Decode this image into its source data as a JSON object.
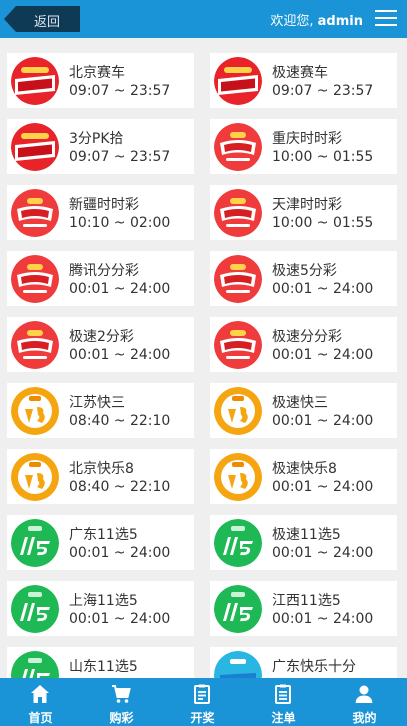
{
  "header": {
    "back_label": "返回",
    "welcome_prefix": "欢迎您, ",
    "username": "admin"
  },
  "lotteries": [
    {
      "name": "北京赛车",
      "time": "09:07 ~ 23:57",
      "icon": "pk10-logo-icon"
    },
    {
      "name": "极速赛车",
      "time": "09:07 ~ 23:57",
      "icon": "pk10-logo-icon"
    },
    {
      "name": "3分PK拾",
      "time": "09:07 ~ 23:57",
      "icon": "pk10-logo-icon"
    },
    {
      "name": "重庆时时彩",
      "time": "10:00 ~ 01:55",
      "icon": "ssc-logo-icon"
    },
    {
      "name": "新疆时时彩",
      "time": "10:10 ~ 02:00",
      "icon": "ssc-logo-icon"
    },
    {
      "name": "天津时时彩",
      "time": "10:00 ~ 01:55",
      "icon": "ssc-logo-icon"
    },
    {
      "name": "腾讯分分彩",
      "time": "00:01 ~ 24:00",
      "icon": "ssc-logo-icon"
    },
    {
      "name": "极速5分彩",
      "time": "00:01 ~ 24:00",
      "icon": "ssc-logo-icon"
    },
    {
      "name": "极速2分彩",
      "time": "00:01 ~ 24:00",
      "icon": "ssc-logo-icon"
    },
    {
      "name": "极速分分彩",
      "time": "00:01 ~ 24:00",
      "icon": "ssc-logo-icon"
    },
    {
      "name": "江苏快三",
      "time": "08:40 ~ 22:10",
      "icon": "k3-logo-icon"
    },
    {
      "name": "极速快三",
      "time": "00:01 ~ 24:00",
      "icon": "k3-logo-icon"
    },
    {
      "name": "北京快乐8",
      "time": "08:40 ~ 22:10",
      "icon": "k3-logo-icon"
    },
    {
      "name": "极速快乐8",
      "time": "00:01 ~ 24:00",
      "icon": "k3-logo-icon"
    },
    {
      "name": "广东11选5",
      "time": "00:01 ~ 24:00",
      "icon": "11x5-logo-icon"
    },
    {
      "name": "极速11选5",
      "time": "00:01 ~ 24:00",
      "icon": "11x5-logo-icon"
    },
    {
      "name": "上海11选5",
      "time": "00:01 ~ 24:00",
      "icon": "11x5-logo-icon"
    },
    {
      "name": "江西11选5",
      "time": "00:01 ~ 24:00",
      "icon": "11x5-logo-icon"
    },
    {
      "name": "山东11选5",
      "time": "",
      "icon": "11x5-logo-icon"
    },
    {
      "name": "广东快乐十分",
      "time": "",
      "icon": "klsf-logo-icon"
    }
  ],
  "nav": [
    {
      "label": "首页",
      "icon": "home-icon"
    },
    {
      "label": "购彩",
      "icon": "cart-icon"
    },
    {
      "label": "开奖",
      "icon": "draw-results-icon"
    },
    {
      "label": "注单",
      "icon": "orders-icon"
    },
    {
      "label": "我的",
      "icon": "user-icon"
    }
  ],
  "colors": {
    "brand": "#1a94d6",
    "pk10": "#e8232a",
    "ssc": "#ef3b3b",
    "k3": "#f5a50f",
    "x11x5": "#1eb855",
    "klsf": "#29b6e3"
  }
}
